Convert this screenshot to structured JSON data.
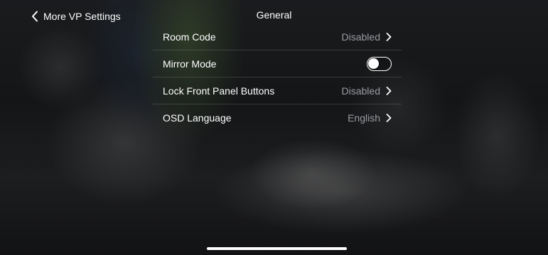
{
  "header": {
    "back_label": "More VP Settings",
    "title": "General"
  },
  "settings": {
    "items": [
      {
        "label": "Room Code",
        "value": "Disabled",
        "control": "disclosure"
      },
      {
        "label": "Mirror Mode",
        "control": "toggle",
        "toggle_on": false
      },
      {
        "label": "Lock Front Panel Buttons",
        "value": "Disabled",
        "control": "disclosure"
      },
      {
        "label": "OSD Language",
        "value": "English",
        "control": "disclosure"
      }
    ]
  },
  "icons": {
    "back": "chevron-left-icon",
    "disclosure": "chevron-right-icon"
  },
  "colors": {
    "text_primary": "#ffffff",
    "text_secondary": "#9a9ba0",
    "separator": "rgba(255,255,255,0.14)"
  }
}
